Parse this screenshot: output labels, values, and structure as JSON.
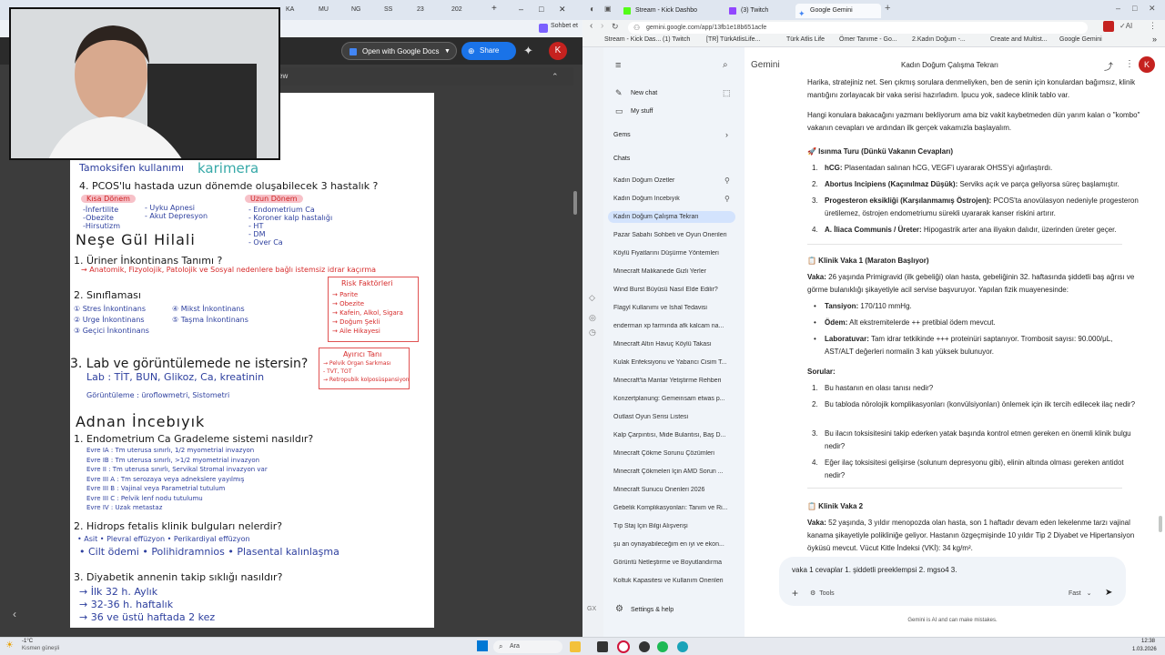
{
  "left_browser": {
    "tabs": [
      "KA",
      "MU",
      "NG",
      "SS",
      "23",
      "202"
    ],
    "chat_button": "Sohbet et",
    "open_with_label": "Open with Google Docs",
    "share_label": "Share",
    "avatar_letter": "K",
    "doc_header_fragment": "ew"
  },
  "notes": {
    "l0": "Tamoksifen kullanımı",
    "watermark": "karimera",
    "l1": "4. PCOS'lu hastada uzun dönemde oluşabilecek 3 hastalık ?",
    "short_term": "Kısa Dönem",
    "long_term": "Uzun Dönem",
    "short_a": "-İnfertilite\n-Obezite\n-Hirsutizm",
    "short_b": "- Uyku Apnesi\n- Akut Depresyon",
    "long_a": "- Endometrium Ca\n- Koroner kalp hastalığı\n- HT\n- DM\n- Over Ca",
    "section1": "Neşe Gül Hilali",
    "q1": "1. Üriner İnkontinans Tanımı ?",
    "q1a": "→ Anatomik, Fizyolojik, Patolojik ve Sosyal nedenlere bağlı istemsiz idrar kaçırma",
    "q2": "2. Sınıflaması",
    "q2a": "① Stres İnkontinans\n② Urge İnkontinans\n③ Geçici İnkontinans",
    "q2b": "④ Mikst İnkontinans\n⑤ Taşma İnkontinans",
    "risk_title": "Risk Faktörleri",
    "risk_items": "→ Parite\n→ Obezite\n→ Kafein, Alkol, Sigara\n→ Doğum Şekli\n→ Aile Hikayesi",
    "q3": "3. Lab ve görüntülemede ne istersin?",
    "q3a": "Lab   : TİT, BUN, Glikoz, Ca, kreatinin",
    "q3b": "Görüntüleme : üroflowmetri, Sistometri",
    "ayirici_title": "Ayırıcı Tanı",
    "ayirici_items": "→ Pelvik Organ Sarkması\n- TVT, TOT\n→ Retropubik kolposüspansiyon",
    "section2": "Adnan İncebıyık",
    "a1": "1. Endometrium Ca Gradeleme sistemi nasıldır?",
    "a1a": "Evre IA : Tm uterusa sınırlı, 1/2 myometrial invazyon\nEvre IB : Tm uterusa sınırlı, >1/2 myometrial invazyon\nEvre II : Tm uterusa sınırlı, Servikal Stromal invazyon var\nEvre III A : Tm serozaya veya adnekslere yayılmış\nEvre III B : Vajinal veya Parametrial tutulum\nEvre III C : Pelvik lenf nodu tutulumu\nEvre IV : Uzak metastaz",
    "a2": "2. Hidrops fetalis klinik bulguları nelerdir?",
    "a2a": "• Asit   • Plevral effüzyon   • Perikardiyal effüzyon",
    "a2b": "• Cilt ödemi  • Polihidramnios  • Plasental kalınlaşma",
    "a3": "3. Diyabetik annenin takip sıklığı nasıldır?",
    "a3a": "→ İlk 32 h.   Aylık",
    "a3b": "→ 32-36 h.   haftalık",
    "a3c": "→ 36 ve üstü   haftada 2 kez"
  },
  "right_browser": {
    "tabs": [
      "Stream - Kick Dashbo",
      "(3) Twitch",
      "Google Gemini"
    ],
    "url": "gemini.google.com/app/13fb1e18b651acfe",
    "bookmarks": [
      "Stream - Kick Das...",
      "(1) Twitch",
      "[TR] TürkAtlisLife...",
      "Türk Atlis Life",
      "Ömer Tanıme - Go...",
      "2.Kadın Doğum -...",
      "Create and Multist...",
      "Google Gemini"
    ],
    "avatar_letter": "K"
  },
  "gemini": {
    "brand": "Gemini",
    "title": "Kadın Doğum Çalışma Tekrarı",
    "new_chat": "New chat",
    "my_stuff": "My stuff",
    "gems": "Gems",
    "chats_header": "Chats",
    "chats": [
      "Kadın Doğum Özetler",
      "Kadın Doğum İncebıyık",
      "Kadın Doğum Çalışma Tekrarı",
      "Pazar Sabahı Sohbeti ve Oyun Önerileri",
      "Köylü Fiyatlarını Düşürme Yöntemleri",
      "Minecraft Malikanede Gizli Yerler",
      "Wind Burst Büyüsü Nasıl Elde Edilir?",
      "Flagyl Kullanımı ve İshal Tedavisi",
      "enderman xp farmında afk kalcam na...",
      "Minecraft Altın Havuç Köylü Takası",
      "Kulak Enfeksiyonu ve Yabancı Cisim T...",
      "Minecraft'ta Mantar Yetiştirme Rehberi",
      "Konzertplanung: Gemeinsam etwas p...",
      "Outlast Oyun Serisi Listesi",
      "Kalp Çarpıntısı, Mide Bulantısı, Baş D...",
      "Minecraft Çökme Sorunu Çözümleri",
      "Minecraft Çökmeleri İçin AMD Sorun ...",
      "Minecraft Sunucu Önerileri 2026",
      "Gebelik Komplikasyonları: Tanım ve Ri...",
      "Tıp Staj İçin Bilgi Alışverişi",
      "şu an oynayabileceğim en iyi ve ekon...",
      "Görüntü Netleştirme ve Boyutlandırma",
      "Koltuk Kapasitesi ve Kullanım Önerileri"
    ],
    "settings": "Settings & help",
    "p0": "Harika, stratejiniz net. Sen çıkmış sorulara denmeliyken, ben de senin için konulardan bağımsız, klinik mantığını zorlayacak bir vaka serisi hazırladım. İpucu yok, sadece klinik tablo var.",
    "p1": "Hangi konulara bakacağını yazmanı bekliyorum ama biz vakit kaybetmeden dün yarım kalan o \"kombo\" vakanın cevapları ve ardından ilk gerçek vakamızla başlayalım.",
    "h1": "🚀 Isınma Turu (Dünkü Vakanın Cevapları)",
    "w1b": "hCG:",
    "w1": " Plasentadan salınan hCG, VEGF'i uyararak OHSS'yi ağırlaştırdı.",
    "w2b": "Abortus Incipiens (Kaçınılmaz Düşük):",
    "w2": " Serviks açık ve parça geliyorsa süreç başlamıştır.",
    "w3b": "Progesteron eksikliği (Karşılanmamış Östrojen):",
    "w3": " PCOS'ta anovülasyon nedeniyle progesteron üretilemez, östrojen endometriumu sürekli uyararak kanser riskini artırır.",
    "w4b": "A. İliaca Communis / Üreter:",
    "w4": " Hipogastrik arter ana iliyakın dalıdır, üzerinden üreter geçer.",
    "h2": "📋 Klinik Vaka 1 (Maraton Başlıyor)",
    "v1b": "Vaka:",
    "v1": " 26 yaşında Primigravid (ilk gebeliği) olan hasta, gebeliğinin 32. haftasında şiddetli baş ağrısı ve görme bulanıklığı şikayetiyle acil servise başvuruyor. Yapılan fizik muayenesinde:",
    "t1b": "Tansiyon:",
    "t1": " 170/110 mmHg.",
    "t2b": "Ödem:",
    "t2": " Alt ekstremitelerde ++ pretibial ödem mevcut.",
    "t3b": "Laboratuvar:",
    "t3": " Tam idrar tetkikinde +++ proteinüri saptanıyor. Trombosit sayısı: 90.000/μL, AST/ALT değerleri normalin 3 katı yüksek bulunuyor.",
    "sorular": "Sorular:",
    "s1": "Bu hastanın en olası tanısı nedir?",
    "s2": "Bu tabloda nörolojik komplikasyonları (konvülsiyonları) önlemek için ilk tercih edilecek ilaç nedir?",
    "s3": "Bu ilacın toksisitesini takip ederken yatak başında kontrol etmen gereken en önemli klinik bulgu nedir?",
    "s4": "Eğer ilaç toksisitesi gelişirse (solunum depresyonu gibi), elinin altında olması gereken antidot nedir?",
    "h3": "📋 Klinik Vaka 2",
    "v2b": "Vaka:",
    "v2": " 52 yaşında, 3 yıldır menopozda olan hasta, son 1 haftadır devam eden lekelenme tarzı vajinal kanama şikayetiyle polikliniğe geliyor. Hastanın özgeçmişinde 10 yıldır Tip 2 Diyabet ve Hipertansiyon öyküsü mevcut. Vücut Kitle İndeksi (VKİ): 34 kg/m².",
    "input_text": "vaka 1 cevaplar 1. şiddetli preeklempsi 2. mgso4 3.",
    "tools": "Tools",
    "mode": "Fast",
    "disclaimer": "Gemini is AI and can make mistakes."
  },
  "taskbar": {
    "weather_temp": "-1°C",
    "weather_desc": "Kısmen güneşli",
    "search": "Ara",
    "time": "12:38",
    "date": "1.03.2026"
  }
}
